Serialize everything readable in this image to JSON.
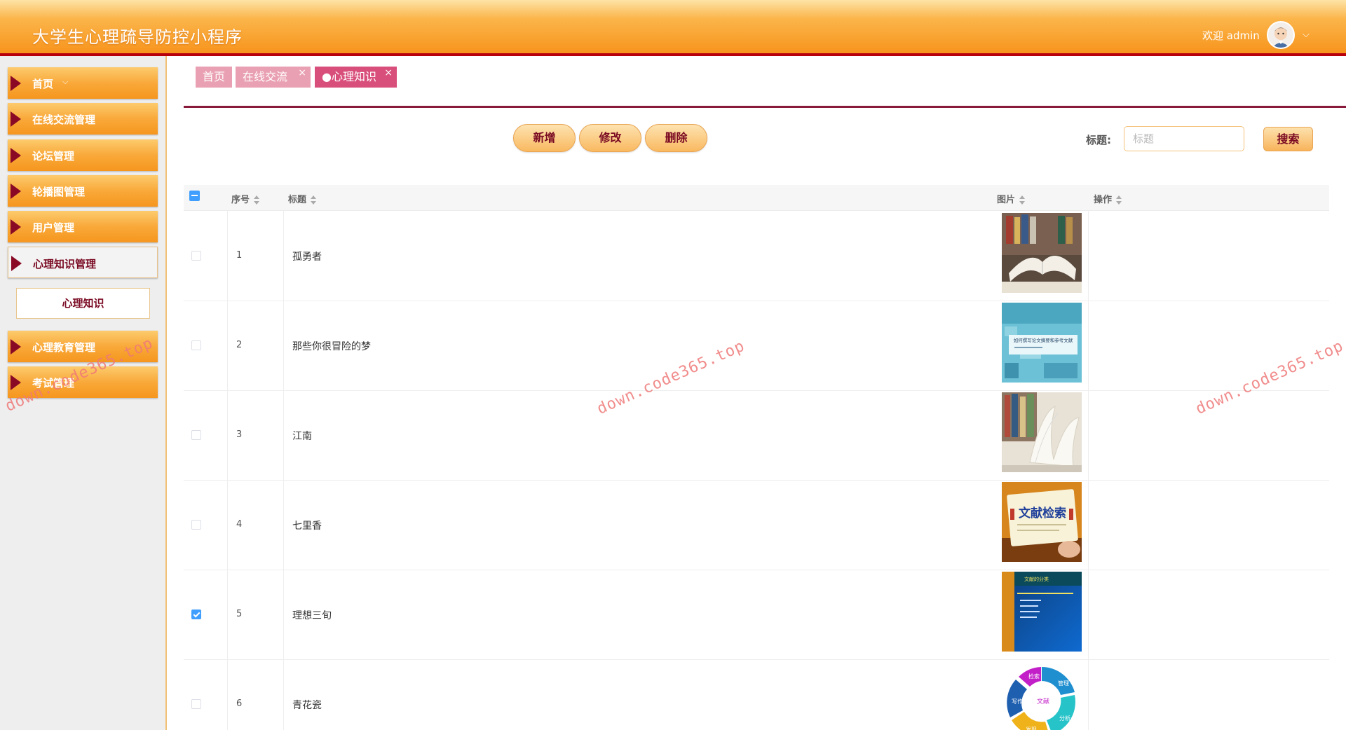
{
  "header": {
    "app_title": "大学生心理疏导防控小程序",
    "welcome": "欢迎 admin",
    "user_caret": "⌵"
  },
  "sidebar": {
    "items": [
      {
        "label": "首页",
        "chevron": "⌵"
      },
      {
        "label": "在线交流管理"
      },
      {
        "label": "论坛管理"
      },
      {
        "label": "轮播图管理"
      },
      {
        "label": "用户管理"
      },
      {
        "label": "心理知识管理",
        "active": true
      },
      {
        "label": "心理教育管理"
      },
      {
        "label": "考试管理"
      }
    ],
    "submenu": {
      "label": "心理知识"
    }
  },
  "tabs": [
    {
      "label": "首页"
    },
    {
      "label": "在线交流",
      "close": "×"
    },
    {
      "label": "●心理知识",
      "close": "×",
      "active": true
    }
  ],
  "toolbar": {
    "add_label": "新增",
    "edit_label": "修改",
    "delete_label": "删除",
    "search_label": "标题:",
    "search_placeholder": "标题",
    "search_button": "搜索"
  },
  "table": {
    "columns": [
      "序号",
      "标题",
      "图片",
      "操作"
    ],
    "rows": [
      {
        "no": "1",
        "title": "孤勇者",
        "checked": false,
        "image": "open-book"
      },
      {
        "no": "2",
        "title": "那些你很冒险的梦",
        "checked": false,
        "image": "document-cover"
      },
      {
        "no": "3",
        "title": "江南",
        "checked": false,
        "image": "open-book"
      },
      {
        "no": "4",
        "title": "七里香",
        "checked": false,
        "image": "literature-search-card"
      },
      {
        "no": "5",
        "title": "理想三旬",
        "checked": true,
        "image": "blue-slide"
      },
      {
        "no": "6",
        "title": "青花瓷",
        "checked": false,
        "image": "cycle-diagram"
      }
    ]
  },
  "image_texts": {
    "document_cover": "如何撰写论文摘要和参考文献",
    "literature_search": "文献检索",
    "blue_slide": "文献的分类",
    "cycle": [
      "检索",
      "管理",
      "分析",
      "写作",
      "发现",
      "文献"
    ]
  },
  "watermark": "down.code365.top",
  "colors": {
    "header_orange": "#f7941d",
    "header_border": "#b8000d",
    "accent_maroon": "#7a0a23",
    "tab_active": "#d94f7c",
    "checkbox_blue": "#409eff"
  }
}
